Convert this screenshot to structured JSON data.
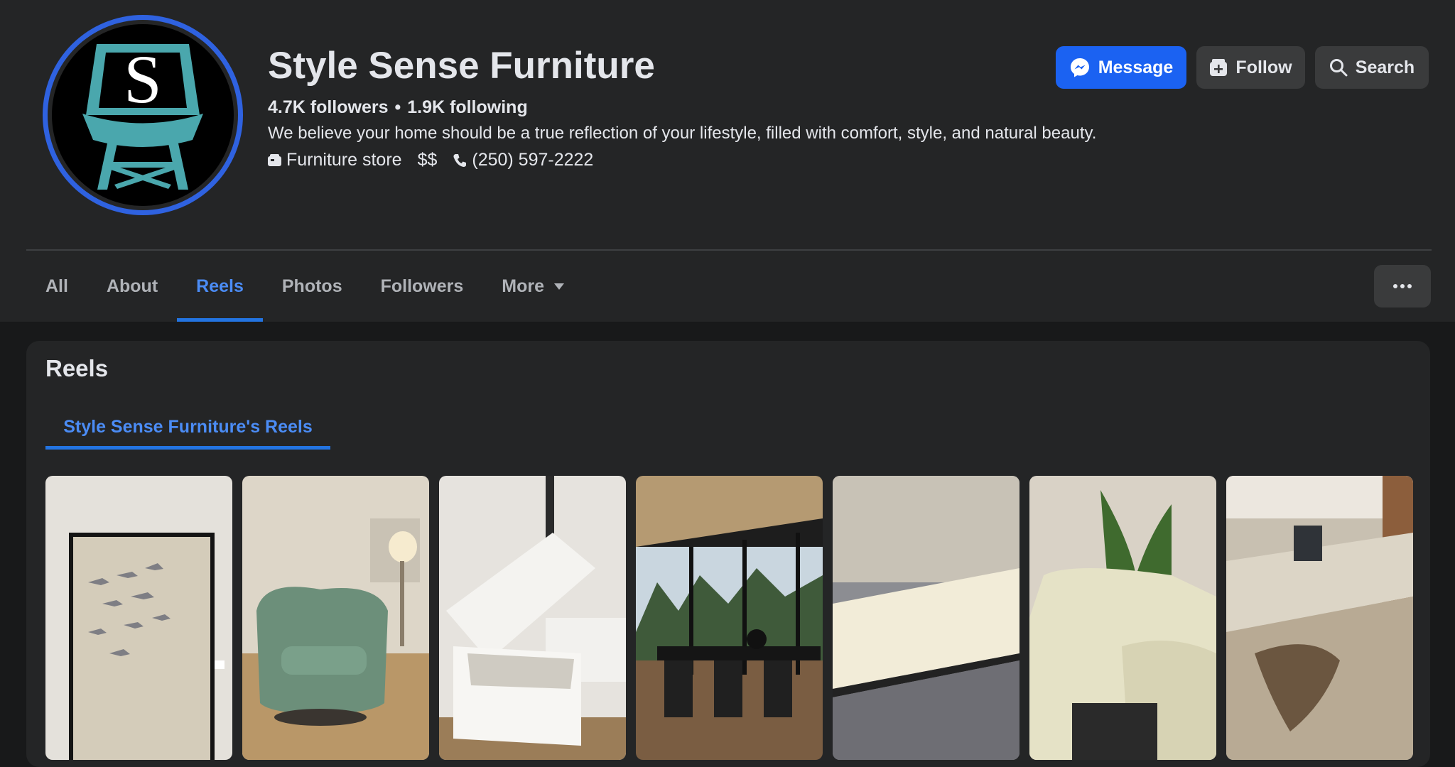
{
  "profile": {
    "name": "Style Sense Furniture",
    "followers": "4.7K followers",
    "separator": "•",
    "following": "1.9K following",
    "bio": "We believe your home should be a true reflection of your lifestyle, filled with comfort, style, and natural beauty.",
    "category": "Furniture store",
    "price_range": "$$",
    "phone": "(250) 597-2222",
    "logo_letter": "S"
  },
  "actions": {
    "message": "Message",
    "follow": "Follow",
    "search": "Search"
  },
  "tabs": [
    {
      "label": "All"
    },
    {
      "label": "About"
    },
    {
      "label": "Reels",
      "active": true
    },
    {
      "label": "Photos"
    },
    {
      "label": "Followers"
    },
    {
      "label": "More"
    }
  ],
  "reels_section": {
    "title": "Reels",
    "subtab": "Style Sense Furniture's Reels"
  },
  "colors": {
    "accent": "#1b62f2",
    "active_tab": "#4b8cf5",
    "logo_teal": "#4aa7ad",
    "avatar_ring": "#2f62e0"
  }
}
